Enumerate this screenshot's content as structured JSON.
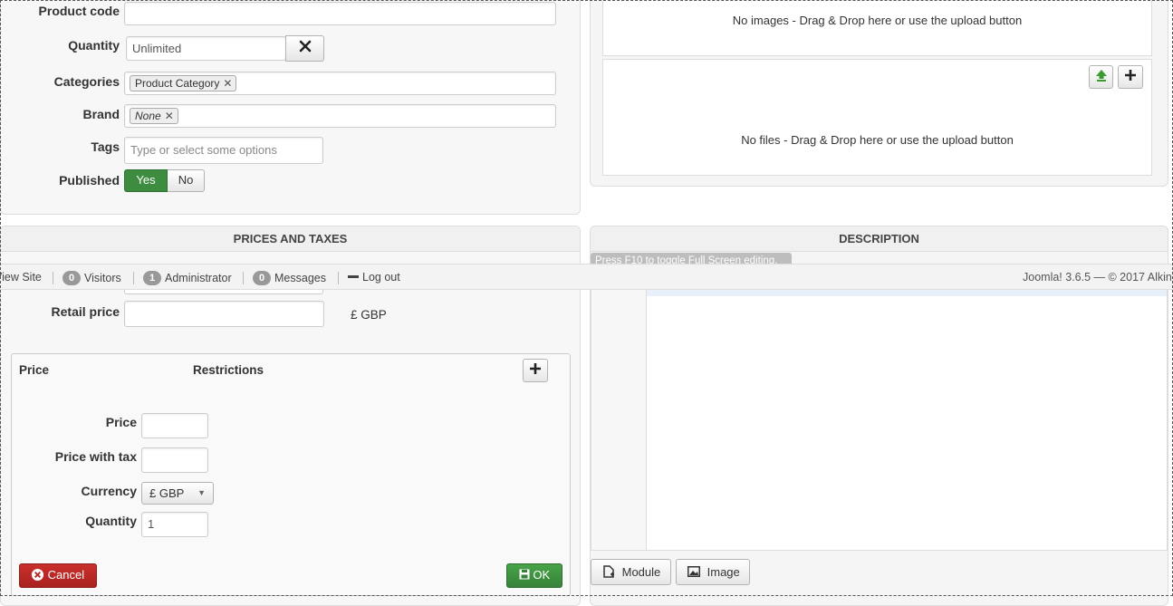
{
  "product_form": {
    "product_code_label": "Product code",
    "product_code_value": "",
    "quantity_label": "Quantity",
    "quantity_value": "Unlimited",
    "categories_label": "Categories",
    "category_chip": "Product Category",
    "brand_label": "Brand",
    "brand_chip": "None",
    "tags_label": "Tags",
    "tags_placeholder": "Type or select some options",
    "published_label": "Published",
    "published_yes": "Yes",
    "published_no": "No",
    "published_value": "Yes"
  },
  "media": {
    "images_dropzone_text": "No images - Drag & Drop here or use the upload button",
    "files_dropzone_text": "No files - Drag & Drop here or use the upload button"
  },
  "prices_panel": {
    "title": "PRICES AND TAXES",
    "retail_price_label": "Retail price",
    "retail_price_value": "",
    "currency_suffix": "£ GBP",
    "restrictions": {
      "col_price": "Price",
      "col_restrictions": "Restrictions",
      "price_label": "Price",
      "price_value": "",
      "price_with_tax_label": "Price with tax",
      "price_with_tax_value": "",
      "currency_label": "Currency",
      "currency_value": "£ GBP",
      "quantity_label": "Quantity",
      "quantity_value": "1",
      "cancel_label": "Cancel",
      "ok_label": "OK"
    }
  },
  "description_panel": {
    "title": "DESCRIPTION",
    "editor_hint": "Press F10 to toggle Full Screen editing.",
    "module_button": "Module",
    "image_button": "Image"
  },
  "statusbar": {
    "view_site": "View Site",
    "visitors_count": "0",
    "visitors_label": "Visitors",
    "admin_count": "1",
    "admin_label": "Administrator",
    "messages_count": "0",
    "messages_label": "Messages",
    "logout_label": "Log out",
    "footer_text": "Joomla! 3.6.5 — © 2017 Alkin"
  },
  "colors": {
    "published_yes": "#3d8c40",
    "cancel_button": "#bd2c28",
    "ok_button": "#3e9440",
    "upload_icon": "#3b9b2e"
  },
  "icons": {
    "clear_quantity": "close-icon",
    "upload_files": "upload-icon",
    "add_file": "plus-icon",
    "add_restriction": "plus-icon",
    "logout": "minus-icon",
    "cancel": "cancel-circle-icon",
    "ok": "save-icon",
    "module": "file-add-icon",
    "image": "picture-icon"
  }
}
